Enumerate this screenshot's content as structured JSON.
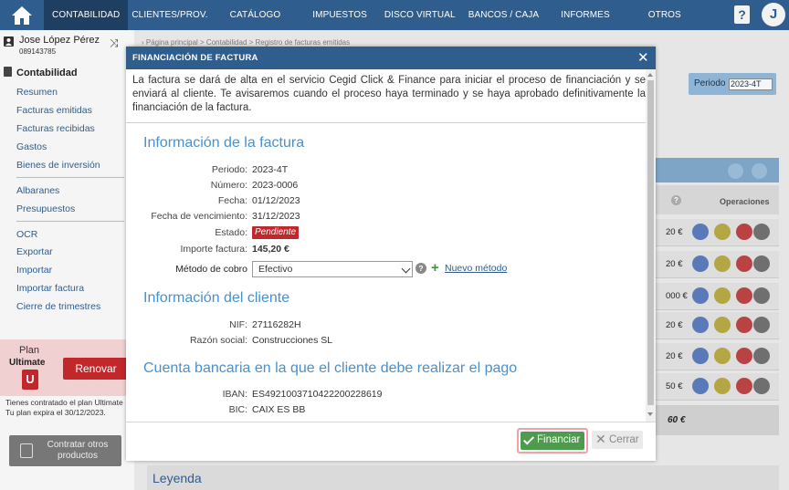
{
  "nav": {
    "items": [
      "CONTABILIDAD",
      "CLIENTES/PROV.",
      "CATÁLOGO",
      "IMPUESTOS",
      "DISCO VIRTUAL",
      "BANCOS / CAJA",
      "INFORMES",
      "OTROS"
    ],
    "help": "?",
    "avatar": "J"
  },
  "sidebar": {
    "user_name": "Jose López Pérez",
    "user_id": "089143785",
    "section": "Contabilidad",
    "group1": [
      "Resumen",
      "Facturas emitidas",
      "Facturas recibidas",
      "Gastos",
      "Bienes de inversión"
    ],
    "group2": [
      "Albaranes",
      "Presupuestos"
    ],
    "group3": [
      "OCR",
      "Exportar",
      "Importar",
      "Importar factura",
      "Cierre de trimestres"
    ],
    "plan_label": "Plan",
    "plan_name": "Ultimate",
    "plan_badge": "U",
    "renew": "Renovar",
    "plan_info_1": "Tienes contratado el plan Ultimate",
    "plan_info_2": "Tu plan expira el 30/12/2023.",
    "more_products": "Contratar otros productos"
  },
  "main": {
    "breadcrumb": "› Página principal > Contabilidad > Registro de facturas emitidas",
    "periodo_label": "Periodo",
    "periodo_value": "2023-4T",
    "ops_label": "Operaciones",
    "row_amounts": [
      "20 €",
      "20 €",
      "000 €",
      "20 €",
      "20 €",
      "50 €"
    ],
    "total": "60 €",
    "legend": "Leyenda"
  },
  "modal": {
    "title": "FINANCIACIÓN DE FACTURA",
    "intro": "La factura se dará de alta en el servicio Cegid Click & Finance para iniciar el proceso de financiación y se enviará al cliente. Te avisaremos cuando el proceso haya terminado y se haya aprobado definitivamente la financiación de la factura.",
    "invoice_section": "Información de la factura",
    "periodo_lbl": "Periodo:",
    "periodo_val": "2023-4T",
    "numero_lbl": "Número:",
    "numero_val": "2023-0006",
    "fecha_lbl": "Fecha:",
    "fecha_val": "01/12/2023",
    "venc_lbl": "Fecha de vencimiento:",
    "venc_val": "31/12/2023",
    "estado_lbl": "Estado:",
    "estado_val": "Pendiente",
    "importe_lbl": "Importe factura:",
    "importe_val": "145,20 €",
    "metodo_lbl": "Método de cobro",
    "metodo_val": "Efectivo",
    "nuevo_metodo": "Nuevo método",
    "client_section": "Información del cliente",
    "nif_lbl": "NIF:",
    "nif_val": "27116282H",
    "razon_lbl": "Razón social:",
    "razon_val": "Construcciones SL",
    "bank_section": "Cuenta bancaria en la que el cliente debe realizar el pago",
    "iban_lbl": "IBAN:",
    "iban_val": "ES4921003710422200228619",
    "bic_lbl": "BIC:",
    "bic_val": "CAIX ES BB",
    "btn_financiar": "Financiar",
    "btn_cerrar": "Cerrar"
  },
  "colors": {
    "primary": "#2e5d8e",
    "accent_blue": "#4a90cc",
    "danger": "#c0282c",
    "success": "#4e9b4e"
  }
}
